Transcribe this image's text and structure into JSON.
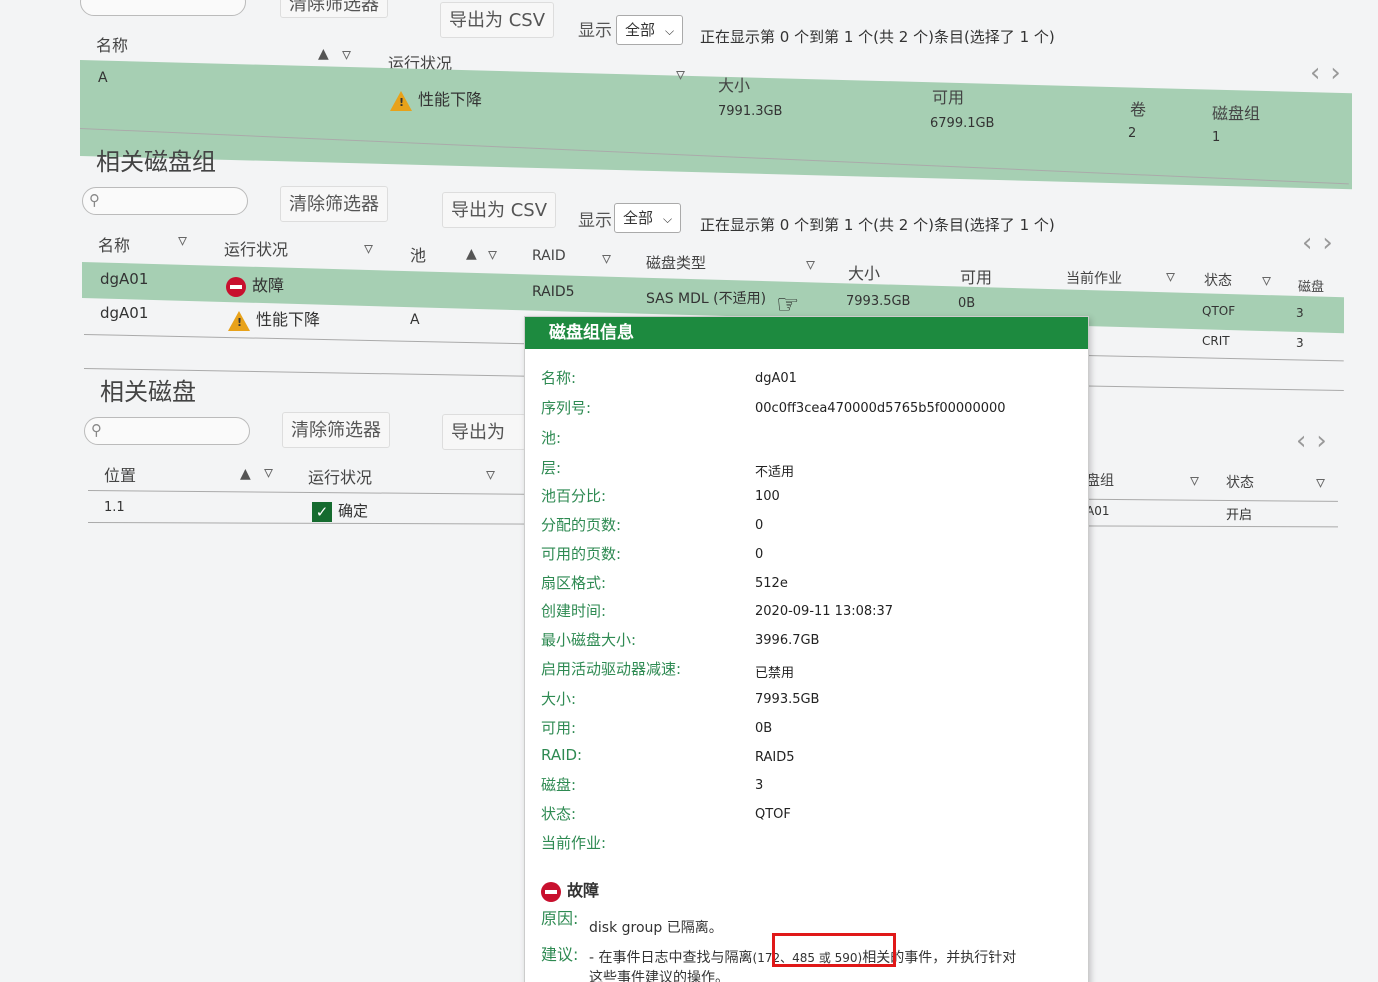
{
  "top": {
    "clear_label": "清除筛选器",
    "export_label": "导出为 CSV",
    "show_label": "显示",
    "show_value": "全部",
    "showing_text": "正在显示第 0 个到第 1 个(共 2 个)条目(选择了 1 个)",
    "headers": {
      "name": "名称",
      "status": "运行状况",
      "size": "大小",
      "avail": "可用",
      "vol": "卷",
      "dg": "磁盘组"
    },
    "row": {
      "name": "A",
      "status": "性能下降",
      "size": "7991.3GB",
      "avail": "6799.1GB",
      "vol": "2",
      "dg": "1"
    }
  },
  "diskgroups": {
    "title": "相关磁盘组",
    "clear_label": "清除筛选器",
    "export_label": "导出为 CSV",
    "show_label": "显示",
    "show_value": "全部",
    "showing_text": "正在显示第 0 个到第 1 个(共 2 个)条目(选择了 1 个)",
    "headers": {
      "name": "名称",
      "status": "运行状况",
      "pool": "池",
      "raid": "RAID",
      "type": "磁盘类型",
      "size": "大小",
      "avail": "可用",
      "job": "当前作业",
      "state": "状态",
      "disks": "磁盘"
    },
    "rows": [
      {
        "name": "dgA01",
        "status": "故障",
        "pool": "",
        "raid": "RAID5",
        "type": "SAS MDL (不适用)",
        "size": "7993.5GB",
        "avail": "0B",
        "state": "QTOF",
        "disks": "3"
      },
      {
        "name": "dgA01",
        "status": "性能下降",
        "pool": "A",
        "state": "CRIT",
        "disks": "3"
      }
    ]
  },
  "disks": {
    "title": "相关磁盘",
    "clear_label": "清除筛选器",
    "export_label": "导出为 CS",
    "headers": {
      "location": "位置",
      "status": "运行状况",
      "dg": "盘组",
      "state": "状态"
    },
    "row": {
      "location": "1.1",
      "status": "确定",
      "dg": "A01",
      "state": "开启"
    }
  },
  "popup": {
    "title": "磁盘组信息",
    "fields": [
      {
        "label": "名称:",
        "value": "dgA01"
      },
      {
        "label": "序列号:",
        "value": "00c0ff3cea470000d5765b5f00000000"
      },
      {
        "label": "池:",
        "value": ""
      },
      {
        "label": "层:",
        "value": "不适用"
      },
      {
        "label": "池百分比:",
        "value": "100"
      },
      {
        "label": "分配的页数:",
        "value": "0"
      },
      {
        "label": "可用的页数:",
        "value": "0"
      },
      {
        "label": "扇区格式:",
        "value": "512e"
      },
      {
        "label": "创建时间:",
        "value": "2020-09-11 13:08:37"
      },
      {
        "label": "最小磁盘大小:",
        "value": "3996.7GB"
      },
      {
        "label": "启用活动驱动器减速:",
        "value": "已禁用"
      },
      {
        "label": "大小:",
        "value": "7993.5GB"
      },
      {
        "label": "可用:",
        "value": "0B"
      },
      {
        "label": "RAID:",
        "value": "RAID5"
      },
      {
        "label": "磁盘:",
        "value": "3"
      },
      {
        "label": "状态:",
        "value": "QTOF"
      },
      {
        "label": "当前作业:",
        "value": ""
      }
    ],
    "fault_label": "故障",
    "reason_label": "原因:",
    "reason_value": "disk group 已隔离。",
    "advice_label": "建议:",
    "advice_pre": "- 在事件日志中查找与隔离",
    "advice_codes": "(172、485 或 590)",
    "advice_post": "相关的事件，并执行针对",
    "advice_line2": "这些事件建议的操作。"
  },
  "colors": {
    "selected_row": "#a6cfb3",
    "popup_header": "#1d8a3f",
    "label_green": "#2e8a52",
    "highlight": "#e01818"
  }
}
